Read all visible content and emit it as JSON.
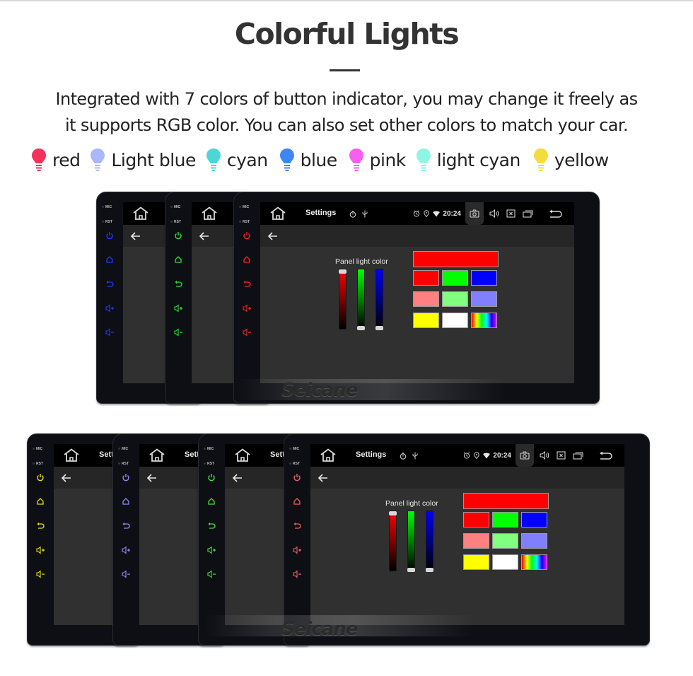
{
  "header": {
    "title": "Colorful Lights",
    "description_line1": "Integrated with 7 colors of button indicator, you may change it freely as",
    "description_line2": "it supports RGB color. You can also set other colors to match your car."
  },
  "legend": [
    {
      "label": "red",
      "color": "#f2325c",
      "icon": "bulb-icon"
    },
    {
      "label": "Light blue",
      "color": "#a9b8f8",
      "icon": "bulb-icon"
    },
    {
      "label": "cyan",
      "color": "#4ed6d6",
      "icon": "bulb-icon"
    },
    {
      "label": "blue",
      "color": "#3f86f3",
      "icon": "bulb-icon"
    },
    {
      "label": "pink",
      "color": "#f85ff0",
      "icon": "bulb-icon"
    },
    {
      "label": "light cyan",
      "color": "#8ff5e4",
      "icon": "bulb-icon"
    },
    {
      "label": "yellow",
      "color": "#f2dd3c",
      "icon": "bulb-icon"
    }
  ],
  "head_unit": {
    "side_tags": {
      "mic": "MIC",
      "rst": "RST"
    },
    "side_buttons": [
      "power-icon",
      "home-icon",
      "back-icon",
      "volume-up-icon",
      "volume-down-icon"
    ],
    "statusbar": {
      "title": "Settings",
      "time": "20:24",
      "left_icons": [
        "timer-icon",
        "usb-icon"
      ],
      "right_icons": [
        "alarm-icon",
        "location-icon",
        "wifi-icon",
        "camera-icon",
        "volume-icon",
        "close-app-icon",
        "recent-apps-icon",
        "return-icon"
      ]
    },
    "settings": {
      "panel_label": "Panel light color",
      "rgb": {
        "red": 255,
        "green": 0,
        "blue": 0
      },
      "preview_color": "#ff0000",
      "swatches": [
        [
          "#ff0000",
          "#00ff00",
          "#0000ff"
        ],
        [
          "#ff8080",
          "#80ff80",
          "#8080ff"
        ],
        [
          "#ffff00",
          "#ffffff",
          "rainbow"
        ]
      ]
    },
    "watermark": "Seicane"
  },
  "row_top": {
    "indicator_colors": [
      "#1c3cff",
      "#2ee02e",
      "#ff2020"
    ]
  },
  "row_bottom": {
    "indicator_colors": [
      "#e8e000",
      "#8c8cff",
      "#40e040",
      "#f06060"
    ]
  }
}
